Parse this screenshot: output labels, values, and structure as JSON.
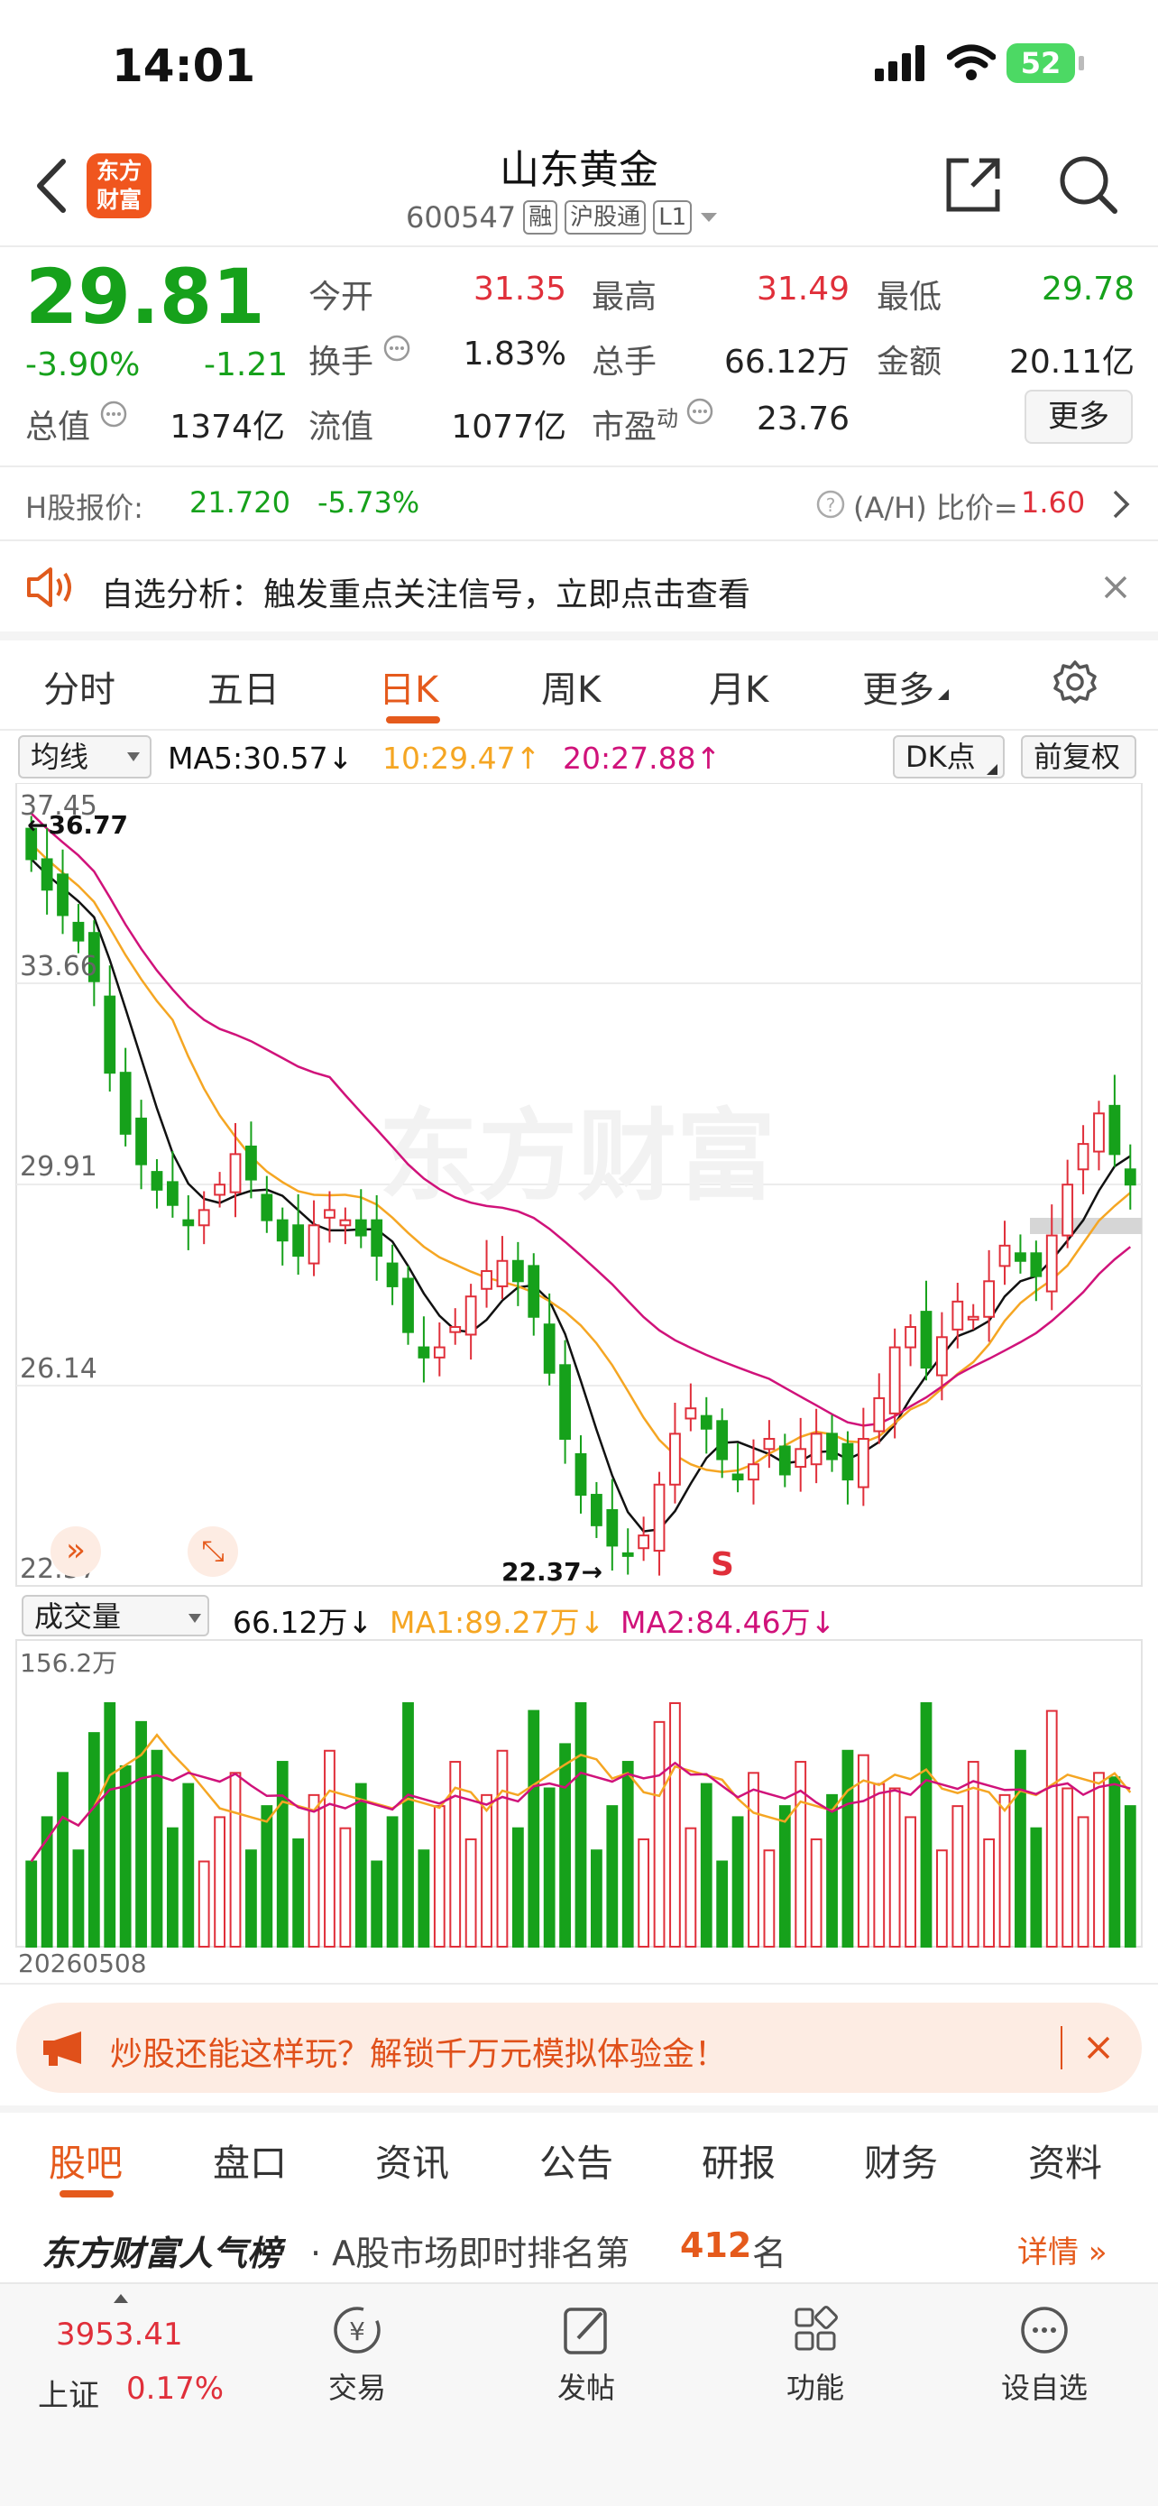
{
  "status": {
    "time": "14:01",
    "battery": "52"
  },
  "header": {
    "logo_text": "东方财富",
    "stock_name": "山东黄金",
    "code": "600547",
    "tags": [
      "融",
      "沪股通",
      "L1"
    ]
  },
  "quote": {
    "price": "29.81",
    "change_pct": "-3.90%",
    "change": "-1.21",
    "open_label": "今开",
    "open": "31.35",
    "high_label": "最高",
    "high": "31.49",
    "low_label": "最低",
    "low": "29.78",
    "turnover_label": "换手",
    "turnover": "1.83%",
    "volume_label": "总手",
    "volume": "66.12万",
    "amount_label": "金额",
    "amount": "20.11亿",
    "mktcap_label": "总值",
    "mktcap": "1374亿",
    "float_label": "流值",
    "float": "1077亿",
    "pe_label": "市盈",
    "pe_sup": "动",
    "pe": "23.76",
    "more_button": "更多"
  },
  "hshare": {
    "label": "H股报价:",
    "price": "21.720",
    "change": "-5.73%",
    "ah_label": "(A/H) 比价=",
    "ah_value": "1.60"
  },
  "alert_banner": {
    "text": "自选分析：触发重点关注信号，立即点击查看"
  },
  "chart_tabs": {
    "items": [
      "分时",
      "五日",
      "日K",
      "周K",
      "月K",
      "更多"
    ],
    "active": "日K"
  },
  "ma_bar": {
    "selector": "均线",
    "ma5": "MA5:30.57",
    "ma10": "10:29.47",
    "ma20": "20:27.88",
    "dk_button": "DK点",
    "adjust_button": "前复权",
    "colors": {
      "ma5": "#111111",
      "ma10": "#f5a623",
      "ma20": "#d0127a",
      "up": "#e02f3a",
      "down": "#16a11b"
    }
  },
  "kline": {
    "y_labels": [
      "37.45",
      "33.66",
      "29.91",
      "26.14",
      "22.37"
    ],
    "high_marker": "36.77",
    "low_marker": "22.37",
    "signal": "S",
    "watermark": "东方财富"
  },
  "volume_bar": {
    "selector": "成交量",
    "vol": "66.12万",
    "ma1": "MA1:89.27万",
    "ma2": "MA2:84.46万",
    "max_label": "156.2万",
    "date_label": "20260508"
  },
  "ad_banner": {
    "text": "炒股还能这样玩？解锁千万元模拟体验金！"
  },
  "bottom_tabs": {
    "items": [
      "股吧",
      "盘口",
      "资讯",
      "公告",
      "研报",
      "财务",
      "资料"
    ],
    "active": "股吧"
  },
  "rank": {
    "brand": "东方财富人气榜",
    "text_pre": "· A股市场即时排名第",
    "rank": "412",
    "text_post": "名",
    "detail": "详情"
  },
  "bottom_nav": {
    "index_value": "3953.41",
    "index_name": "上证",
    "index_change": "0.17%",
    "items": [
      {
        "label": "交易",
        "icon": "trade-icon"
      },
      {
        "label": "发帖",
        "icon": "post-icon"
      },
      {
        "label": "功能",
        "icon": "apps-icon"
      },
      {
        "label": "设自选",
        "icon": "add-watchlist-icon"
      }
    ]
  }
}
